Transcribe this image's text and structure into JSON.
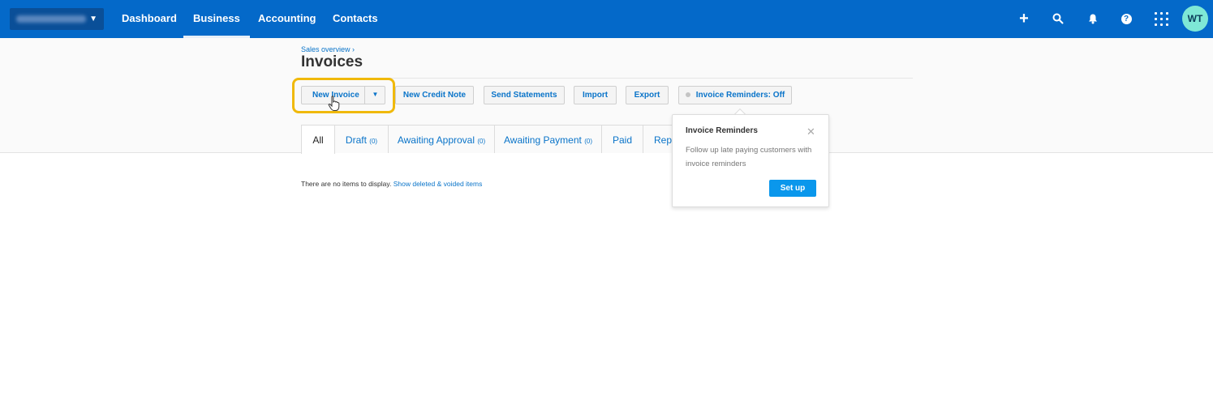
{
  "nav": {
    "items": [
      {
        "label": "Dashboard"
      },
      {
        "label": "Business"
      },
      {
        "label": "Accounting"
      },
      {
        "label": "Contacts"
      }
    ],
    "active_index": 1,
    "avatar_initials": "WT",
    "icons": [
      "plus-icon",
      "search-icon",
      "bell-icon",
      "help-icon",
      "apps-grid-icon"
    ]
  },
  "header": {
    "breadcrumb": "Sales overview ›",
    "title": "Invoices"
  },
  "toolbar": {
    "new_invoice": "New Invoice",
    "new_credit_note": "New Credit Note",
    "send_statements": "Send Statements",
    "import": "Import",
    "export": "Export",
    "invoice_reminders": "Invoice Reminders: Off"
  },
  "tabs": [
    {
      "label": "All",
      "count": ""
    },
    {
      "label": "Draft",
      "count": "(0)"
    },
    {
      "label": "Awaiting Approval",
      "count": "(0)"
    },
    {
      "label": "Awaiting Payment",
      "count": "(0)"
    },
    {
      "label": "Paid",
      "count": ""
    },
    {
      "label": "Rep",
      "count": ""
    }
  ],
  "empty_state": {
    "message": "There are no items to display.",
    "link": "Show deleted & voided items"
  },
  "popover": {
    "title": "Invoice Reminders",
    "body": "Follow up late paying customers with invoice reminders",
    "button": "Set up"
  },
  "colors": {
    "nav_bg": "#0469c9",
    "link": "#0a74c9",
    "highlight": "#f0b90b",
    "primary_button": "#0a97ec",
    "avatar": "#7ee8d6"
  }
}
